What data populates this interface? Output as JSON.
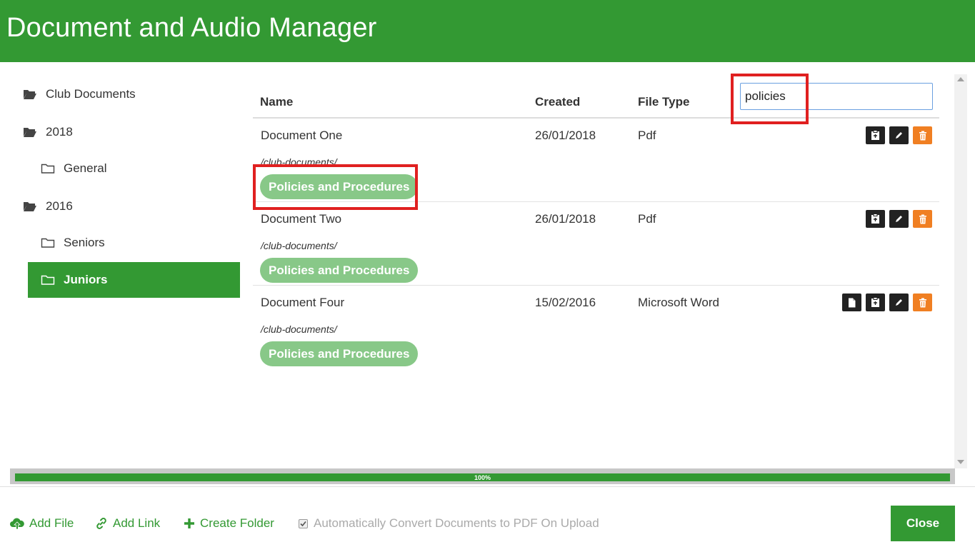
{
  "header": {
    "title": "Document and Audio Manager"
  },
  "sidebar": {
    "folders": [
      {
        "label": "Club Documents",
        "level": 0,
        "open": true
      },
      {
        "label": "2018",
        "level": 0,
        "open": true
      },
      {
        "label": "General",
        "level": 1,
        "open": false
      },
      {
        "label": "2016",
        "level": 0,
        "open": true
      },
      {
        "label": "Seniors",
        "level": 1,
        "open": false
      },
      {
        "label": "Juniors",
        "level": 1,
        "open": false,
        "active": true
      }
    ]
  },
  "table": {
    "columns": {
      "name": "Name",
      "created": "Created",
      "file_type": "File Type"
    },
    "search": {
      "value": "policies"
    },
    "rows": [
      {
        "name": "Document One",
        "path": "/club-documents/",
        "tag": "Policies and Procedures",
        "created": "26/01/2018",
        "file_type": "Pdf",
        "actions": [
          "clipboard-icon",
          "edit-icon",
          "delete-icon"
        ]
      },
      {
        "name": "Document Two",
        "path": "/club-documents/",
        "tag": "Policies and Procedures",
        "created": "26/01/2018",
        "file_type": "Pdf",
        "actions": [
          "clipboard-icon",
          "edit-icon",
          "delete-icon"
        ]
      },
      {
        "name": "Document Four",
        "path": "/club-documents/",
        "tag": "Policies and Procedures",
        "created": "15/02/2016",
        "file_type": "Microsoft Word",
        "actions": [
          "file-icon",
          "clipboard-icon",
          "edit-icon",
          "delete-icon"
        ]
      }
    ]
  },
  "progress": {
    "value": 1.0,
    "label": "100%"
  },
  "footer": {
    "add_file": "Add File",
    "add_link": "Add Link",
    "create_folder": "Create Folder",
    "auto_convert": "Automatically Convert Documents to PDF On Upload",
    "auto_convert_checked": true,
    "close": "Close"
  },
  "colors": {
    "brand": "#339933",
    "tag": "#88c888",
    "delete": "#f07f22",
    "highlight": "#e02020"
  }
}
